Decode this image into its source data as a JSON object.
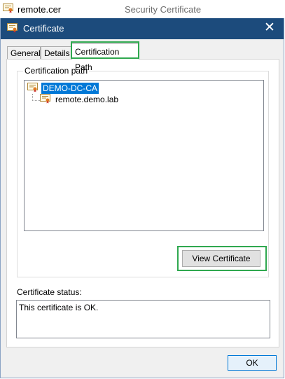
{
  "topstrip": {
    "file_name": "remote.cer",
    "app_title": "Security Certificate"
  },
  "window": {
    "title": "Certificate",
    "close_glyph": "✕"
  },
  "tabs": [
    {
      "label": "General"
    },
    {
      "label": "Details"
    },
    {
      "label": "Certification Path"
    }
  ],
  "cert_path": {
    "group_label": "Certification path",
    "nodes": [
      {
        "label": "DEMO-DC-CA",
        "selected": true
      },
      {
        "label": "remote.demo.lab",
        "selected": false
      }
    ],
    "view_button": "View Certificate"
  },
  "status": {
    "label": "Certificate status:",
    "text": "This certificate is OK."
  },
  "footer": {
    "ok_label": "OK"
  },
  "colors": {
    "titlebar": "#1c4b7c",
    "selection": "#0078d7",
    "highlight": "#2fa84f"
  },
  "icons": [
    "certificate-icon",
    "close-icon"
  ]
}
